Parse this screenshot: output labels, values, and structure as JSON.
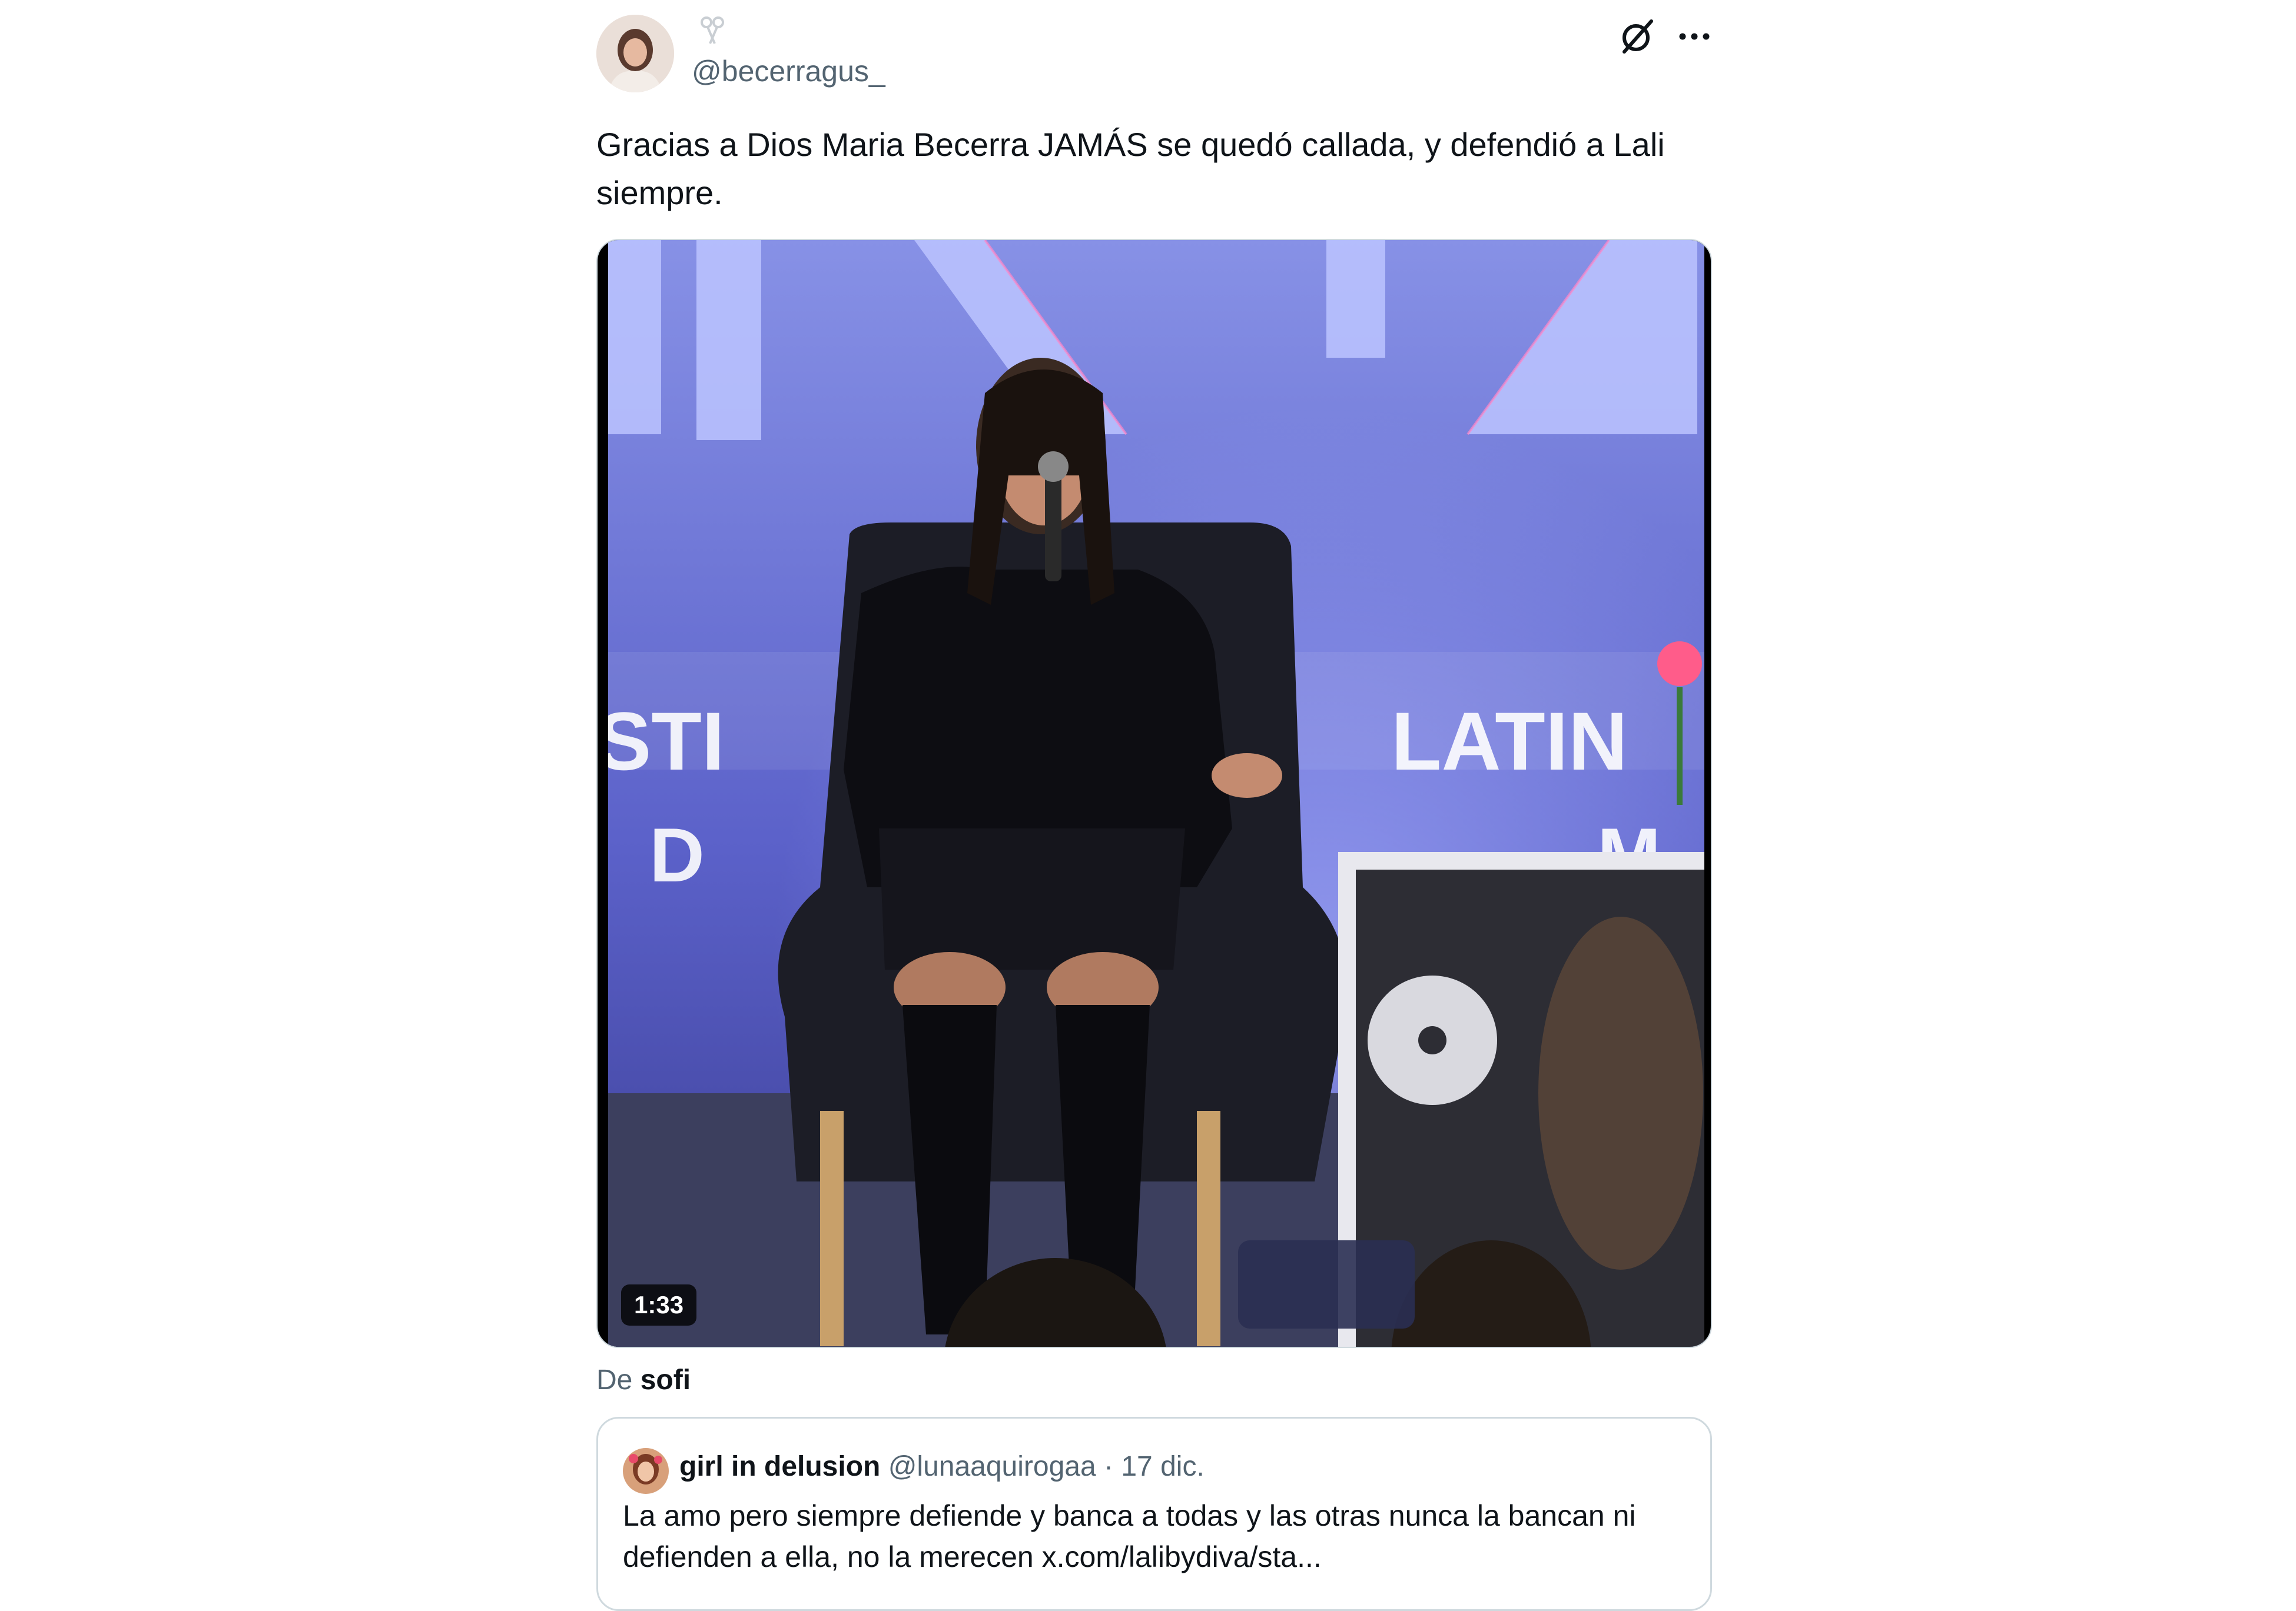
{
  "post": {
    "handle": "@becerragus_",
    "text": "Gracias a Dios Maria Becerra JAMÁS se quedó callada, y defendió a Lali siempre."
  },
  "header_icons": {
    "display_name_icon": "ribbon-emoji-icon",
    "grok": "grok-icon",
    "more": "more-icon"
  },
  "media": {
    "duration": "1:33",
    "stage_text_left": "STI",
    "stage_text_right": "LATIN",
    "stage_text_lower_left": "D",
    "stage_text_lower_right": "M"
  },
  "attribution": {
    "prefix": "De",
    "author": "sofi"
  },
  "quote": {
    "name": "girl in delusion",
    "handle": "@lunaaquirogaa",
    "separator": "·",
    "time": "17 dic.",
    "text": "La amo pero siempre defiende y banca a todas y las otras nunca la bancan ni defienden a ella, no la merecen x.com/lalibydiva/sta..."
  },
  "colors": {
    "text": "#0f1419",
    "secondary": "#536471",
    "border": "#cfd9de",
    "stage_blue": "#5a63c8"
  }
}
